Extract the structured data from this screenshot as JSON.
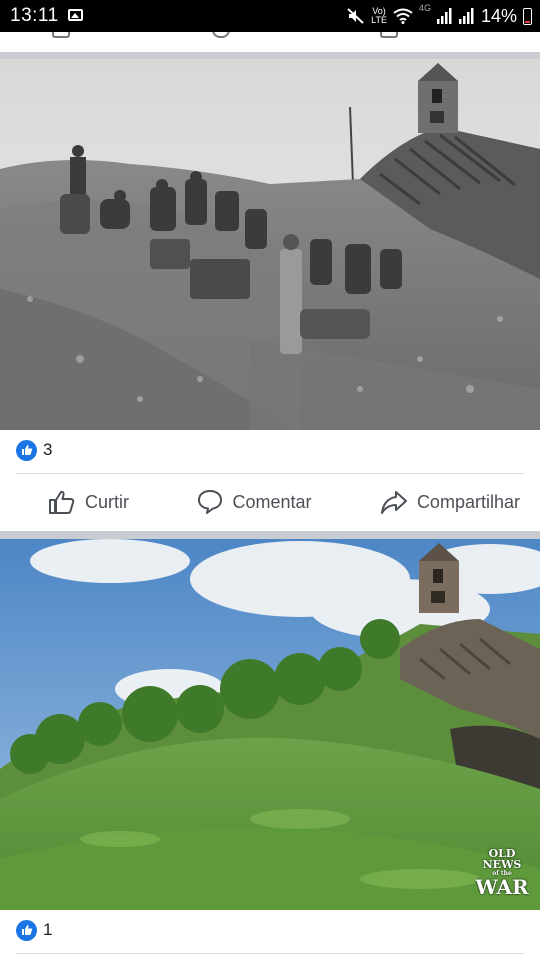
{
  "status_bar": {
    "time": "13:11",
    "network_vo": "Vo)",
    "network_lte": "LTE",
    "network_4g": "4G",
    "battery_percent": "14%"
  },
  "post1": {
    "reaction_count": "3",
    "actions": {
      "like_label": "Curtir",
      "comment_label": "Comentar",
      "share_label": "Compartilhar"
    }
  },
  "post2": {
    "reaction_count": "1",
    "watermark_lines": [
      "OLD",
      "NEWS",
      "of the",
      "WAR"
    ]
  },
  "colors": {
    "facebook_blue": "#1b74e4",
    "action_grey": "#4b4f56",
    "separator": "#c9ccd1"
  }
}
